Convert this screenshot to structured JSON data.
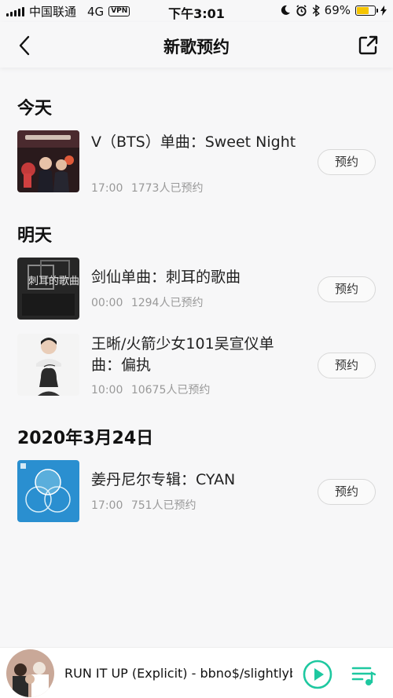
{
  "status_bar": {
    "carrier": "中国联通",
    "network": "4G",
    "vpn": "VPN",
    "time": "下午3:01",
    "battery": "69%",
    "battery_level": 0.69
  },
  "nav": {
    "title": "新歌预约",
    "back_icon": "chevron-left-icon",
    "share_icon": "share-external-icon"
  },
  "sections": [
    {
      "title": "今天",
      "items": [
        {
          "title": "V（BTS）单曲：Sweet Night",
          "time": "17:00",
          "count": "1773人已预约",
          "button": "预约"
        }
      ]
    },
    {
      "title": "明天",
      "items": [
        {
          "title": "剑仙单曲：刺耳的歌曲",
          "time": "00:00",
          "count": "1294人已预约",
          "button": "预约",
          "cover_text": "刺耳的歌曲"
        },
        {
          "title": "王晰/火箭少女101吴宣仪单曲：偏执",
          "time": "10:00",
          "count": "10675人已预约",
          "button": "预约"
        }
      ]
    },
    {
      "title": "2020年3月24日",
      "items": [
        {
          "title": "姜丹尼尔专辑：CYAN",
          "time": "17:00",
          "count": "751人已预约",
          "button": "预约"
        }
      ]
    }
  ],
  "player": {
    "now_playing": "RUN IT UP (Explicit) - bbno$/slightlyblack",
    "play_icon": "play-circle-icon",
    "playlist_icon": "playlist-icon",
    "accent": "#1ec8a0"
  }
}
